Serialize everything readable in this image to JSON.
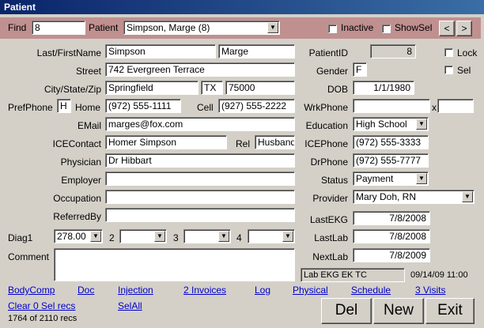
{
  "window": {
    "title": "Patient"
  },
  "findbar": {
    "find_label": "Find",
    "find_value": "8",
    "patient_label": "Patient",
    "patient_value": "Simpson, Marge (8)",
    "inactive_label": "Inactive",
    "showsel_label": "ShowSel",
    "prev_label": "<",
    "next_label": ">"
  },
  "labels": {
    "name": "Last/FirstName",
    "street": "Street",
    "citystatezip": "City/State/Zip",
    "prefphone": "PrefPhone",
    "home": "Home",
    "cell": "Cell",
    "email": "EMail",
    "icecontact": "ICEContact",
    "rel": "Rel",
    "physician": "Physician",
    "employer": "Employer",
    "occupation": "Occupation",
    "referredby": "ReferredBy",
    "diag1": "Diag1",
    "diag2": "2",
    "diag3": "3",
    "diag4": "4",
    "comment": "Comment",
    "patientid": "PatientID",
    "gender": "Gender",
    "dob": "DOB",
    "wrkphone": "WrkPhone",
    "x": "x",
    "education": "Education",
    "icephone": "ICEPhone",
    "drphone": "DrPhone",
    "status": "Status",
    "provider": "Provider",
    "lastekg": "LastEKG",
    "lastlab": "LastLab",
    "nextlab": "NextLab",
    "lock": "Lock",
    "sel": "Sel"
  },
  "fields": {
    "last_name": "Simpson",
    "first_name": "Marge",
    "street": "742 Evergreen Terrace",
    "city": "Springfield",
    "state": "TX",
    "zip": "75000",
    "pref_phone": "H",
    "home_phone": "(972) 555-1111",
    "cell_phone": "(927) 555-2222",
    "email": "marges@fox.com",
    "ice_contact": "Homer Simpson",
    "rel": "Husband",
    "physician": "Dr Hibbart",
    "employer": "",
    "occupation": "",
    "referred_by": "",
    "diag1": "278.00",
    "diag2": "",
    "diag3": "",
    "diag4": "",
    "comment": "",
    "patient_id": "8",
    "gender": "F",
    "dob": "1/1/1980",
    "wrk_phone": "",
    "wrk_ext": "",
    "education": "High School",
    "ice_phone": "(972) 555-3333",
    "dr_phone": "(972) 555-7777",
    "status": "Payment",
    "provider": "Mary Doh, RN",
    "last_ekg": "7/8/2008",
    "last_lab": "7/8/2008",
    "next_lab": "7/8/2009"
  },
  "info": {
    "tests": "Lab EKG EK TC",
    "timestamp": "09/14/09 11:00"
  },
  "links": {
    "bodycomp": "BodyComp",
    "doc": "Doc",
    "injection": "Injection",
    "invoices": "2 Invoices",
    "log": "Log",
    "physical": "Physical",
    "schedule": "Schedule",
    "visits": "3 Visits",
    "clear": "Clear 0 Sel recs",
    "selall": "SelAll"
  },
  "footer": {
    "record_count": "1764 of 2110 recs"
  },
  "buttons": {
    "del": "Del",
    "new": "New",
    "exit": "Exit"
  }
}
